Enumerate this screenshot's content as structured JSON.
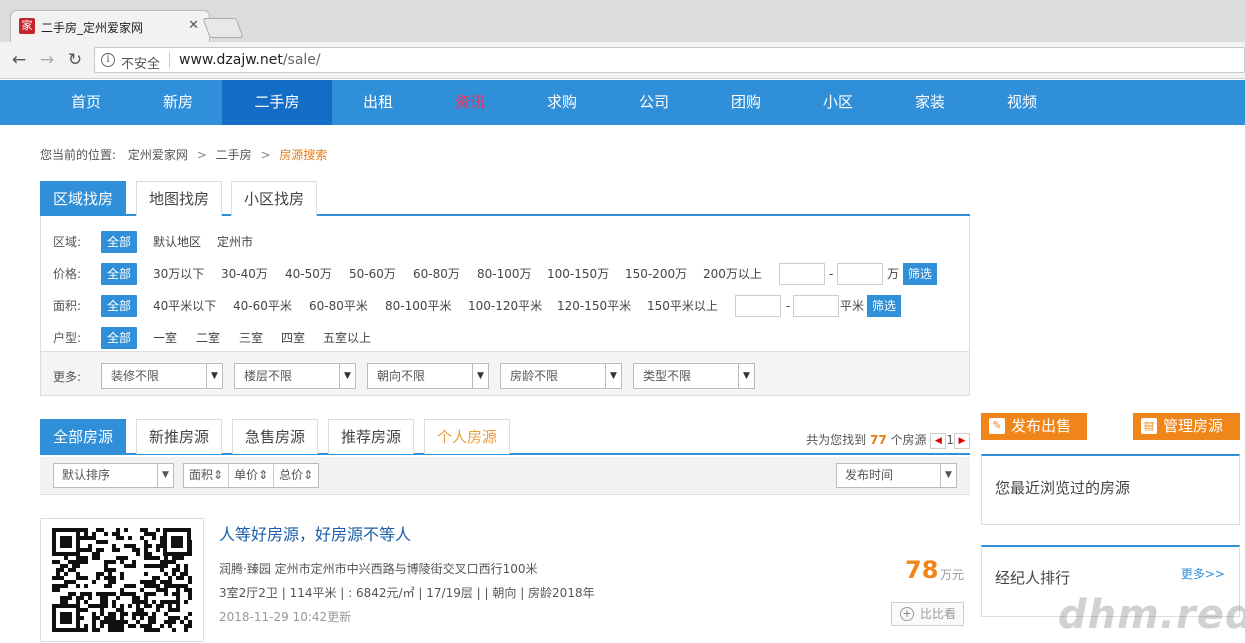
{
  "browser": {
    "tab_title": "二手房_定州爱家网",
    "favicon_text": "家",
    "close_glyph": "✕",
    "back_glyph": "←",
    "forward_glyph": "→",
    "reload_glyph": "↻",
    "info_glyph": "i",
    "security_label": "不安全",
    "url_host": "www.dzajw.net",
    "url_path": "/sale/"
  },
  "nav": {
    "items": [
      "首页",
      "新房",
      "二手房",
      "出租",
      "资讯",
      "求购",
      "公司",
      "团购",
      "小区",
      "家装",
      "视频"
    ],
    "active_index": 2,
    "highlight_index": 4,
    "colors": {
      "bar": "#2f8fd8",
      "active": "#136dc6",
      "highlight": "#ff2a55"
    }
  },
  "breadcrumb": {
    "prefix": "您当前的位置:",
    "items": [
      "定州爱家网",
      "二手房",
      "房源搜索"
    ],
    "sep": ">"
  },
  "search_tabs": [
    "区域找房",
    "地图找房",
    "小区找房"
  ],
  "filters": {
    "region": {
      "label": "区域:",
      "all": "全部",
      "options": [
        "默认地区",
        "定州市"
      ]
    },
    "price": {
      "label": "价格:",
      "all": "全部",
      "options": [
        "30万以下",
        "30-40万",
        "40-50万",
        "50-60万",
        "60-80万",
        "80-100万",
        "100-150万",
        "150-200万",
        "200万以上"
      ],
      "dash": "-",
      "unit": "万",
      "button": "筛选"
    },
    "area": {
      "label": "面积:",
      "all": "全部",
      "options": [
        "40平米以下",
        "40-60平米",
        "60-80平米",
        "80-100平米",
        "100-120平米",
        "120-150平米",
        "150平米以上"
      ],
      "dash": "-",
      "unit": "平米",
      "button": "筛选"
    },
    "layout": {
      "label": "户型:",
      "all": "全部",
      "options": [
        "一室",
        "二室",
        "三室",
        "四室",
        "五室以上"
      ]
    },
    "more": {
      "label": "更多:",
      "selects": [
        "装修不限",
        "楼层不限",
        "朝向不限",
        "房龄不限",
        "类型不限"
      ]
    }
  },
  "list_tabs": [
    "全部房源",
    "新推房源",
    "急售房源",
    "推荐房源",
    "个人房源"
  ],
  "result": {
    "prefix": "共为您找到",
    "count": "77",
    "suffix": "个房源",
    "page": "1",
    "prev": "◀",
    "next": "▶"
  },
  "sort": {
    "default": "默认排序",
    "fields": [
      "面积⇕",
      "单价⇕",
      "总价⇕"
    ],
    "time": "发布时间"
  },
  "listing": {
    "title": "人等好房源，好房源不等人",
    "address": "润腾·臻园  定州市定州市中兴西路与博陵街交叉口西行100米",
    "specs": "3室2厅2卫 | 114平米 | : 6842元/㎡ | 17/19层 |    | 朝向  | 房龄2018年",
    "date": "2018-11-29 10:42更新",
    "price": "78",
    "price_unit": "万元",
    "compare_icon": "+",
    "compare": "比比看"
  },
  "sidebar": {
    "publish": "发布出售",
    "manage": "管理房源",
    "recent": "您最近浏览过的房源",
    "ranking": "经纪人排行",
    "more": "更多>>",
    "accent": "#f08519"
  },
  "watermark": "dhm.red"
}
